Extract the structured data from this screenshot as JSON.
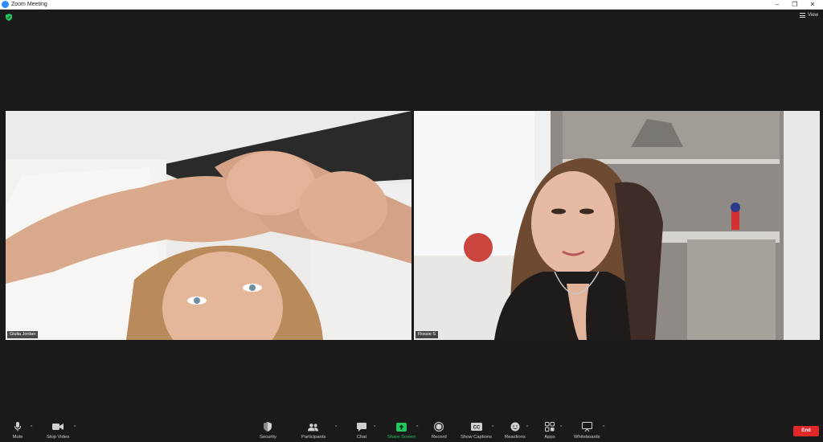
{
  "window": {
    "title": "Zoom Meeting"
  },
  "top": {
    "view_label": "View"
  },
  "participants": [
    {
      "name": "Giulia Jordan"
    },
    {
      "name": "Rossie S"
    }
  ],
  "toolbar": {
    "mute": "Mute",
    "stop_video": "Stop Video",
    "security": "Security",
    "participants": "Participants",
    "chat": "Chat",
    "share_screen": "Share Screen",
    "record": "Record",
    "show_captions": "Show Captions",
    "reactions": "Reactions",
    "apps": "Apps",
    "whiteboards": "Whiteboards",
    "end": "End"
  },
  "colors": {
    "share_green": "#22c55e",
    "end_red": "#e02828",
    "zoom_blue": "#2d8cff"
  }
}
